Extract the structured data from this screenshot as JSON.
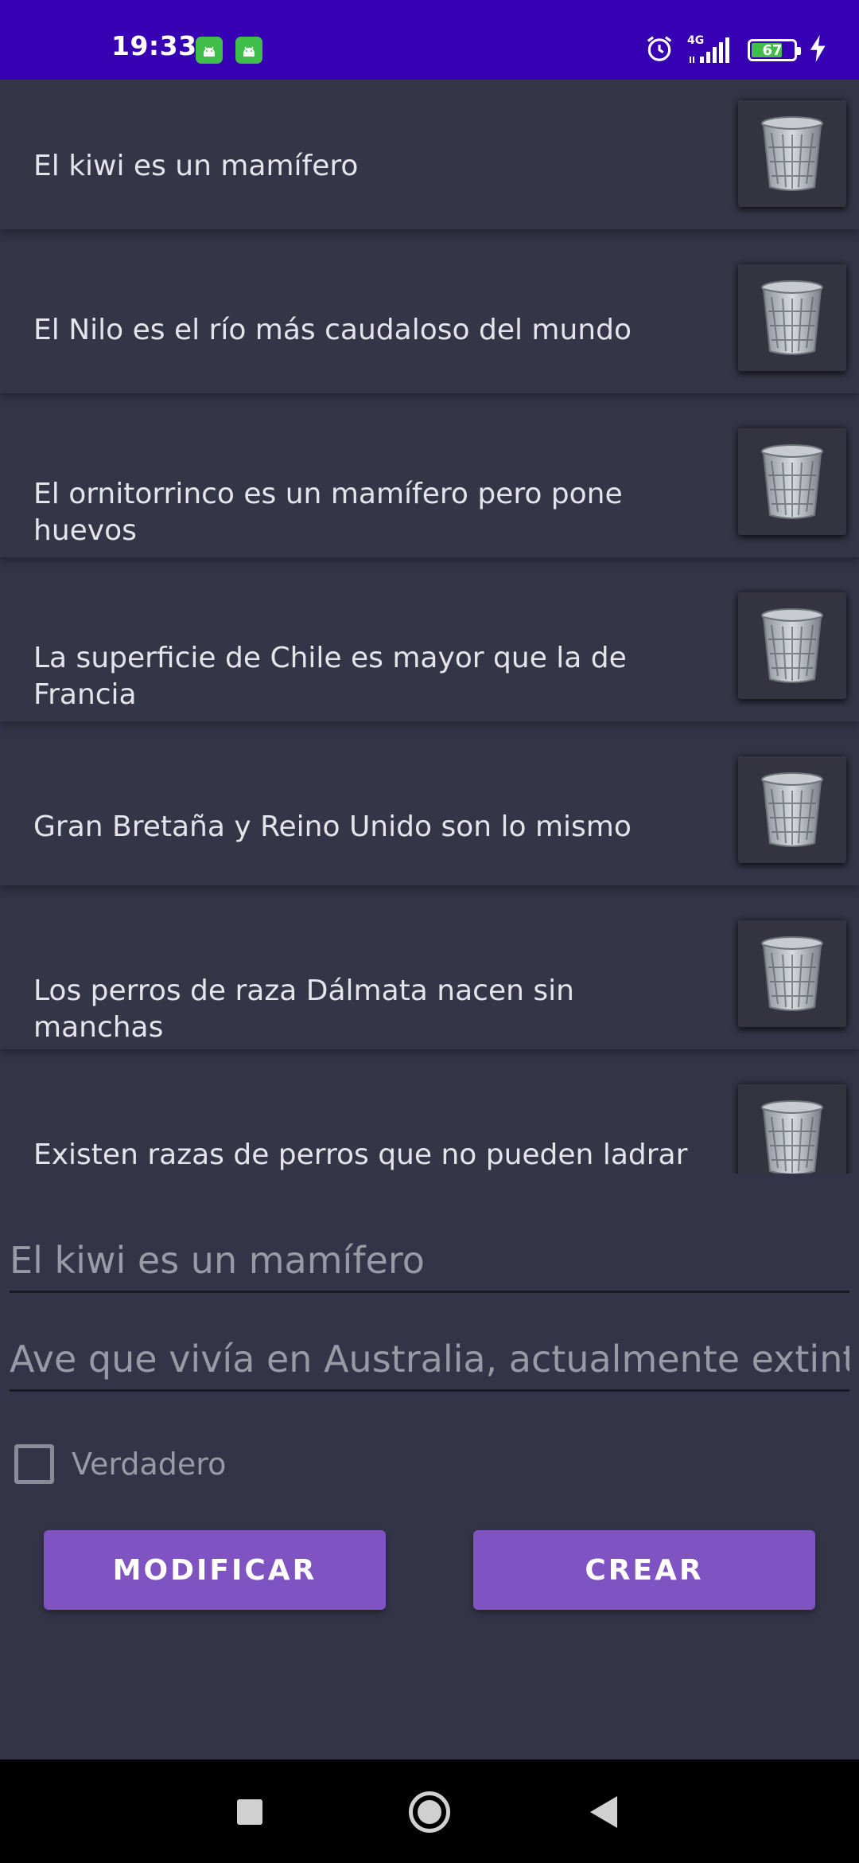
{
  "status_bar": {
    "time": "19:33",
    "notifications": [
      "android-icon",
      "android-icon"
    ],
    "network_label": "4G",
    "battery": "67",
    "icons": [
      "alarm-icon",
      "signal-icon",
      "battery-icon",
      "charging-icon"
    ]
  },
  "questions": [
    {
      "text": "El kiwi es un mamífero",
      "icon": "trash-icon"
    },
    {
      "text": "El Nilo es el río más caudaloso del mundo",
      "icon": "trash-icon"
    },
    {
      "text": "El ornitorrinco es un mamífero pero pone huevos",
      "icon": "trash-icon"
    },
    {
      "text": "La superficie de Chile es mayor que la de Francia",
      "icon": "trash-icon"
    },
    {
      "text": "Gran Bretaña y Reino Unido son lo mismo",
      "icon": "trash-icon"
    },
    {
      "text": "Los perros de raza Dálmata nacen sin manchas",
      "icon": "trash-icon"
    },
    {
      "text": "Existen razas de perros que no pueden ladrar",
      "icon": "trash-icon"
    }
  ],
  "form": {
    "question_value": "El kiwi es un mamífero",
    "explanation_value": "Ave que vivía en Australia, actualmente extinto",
    "checkbox_label": "Verdadero",
    "checkbox_checked": false,
    "modify_button": "MODIFICAR",
    "create_button": "CREAR"
  },
  "colors": {
    "status_bar": "#3700b3",
    "background": "#333447",
    "button": "#7f54c2",
    "battery_fill": "#3fbe4a"
  }
}
